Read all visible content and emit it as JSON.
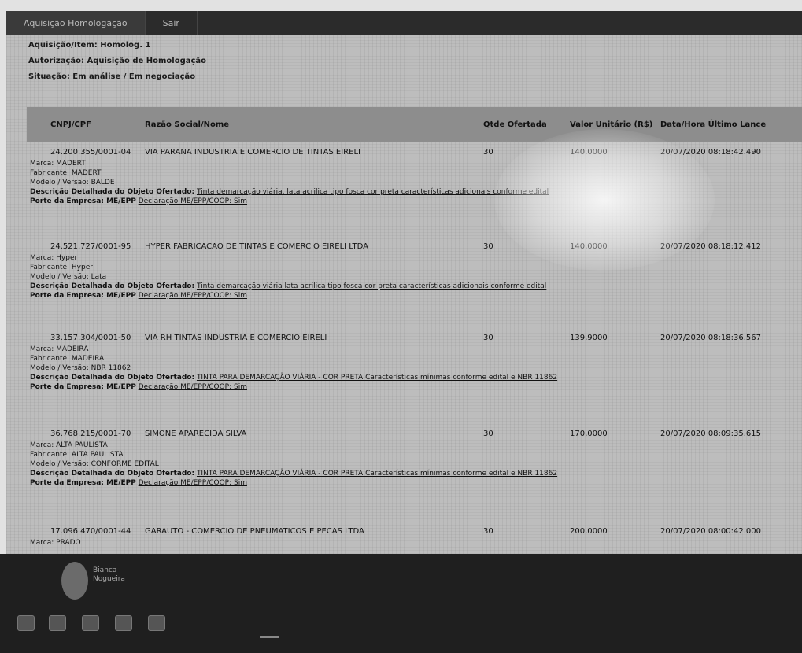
{
  "window": {
    "tabs": [
      {
        "label": "Aquisição Homologação"
      },
      {
        "label": "Sair"
      }
    ]
  },
  "info": {
    "line1": "Aquisição/Item: Homolog. 1",
    "line2": "Autorização: Aquisição de Homologação",
    "line3": "Situação: Em análise / Em negociação"
  },
  "table": {
    "headers": {
      "cnpj": "CNPJ/CPF",
      "razao": "Razão Social/Nome",
      "qtd": "Qtde Ofertada",
      "valor": "Valor Unitário (R$)",
      "data": "Data/Hora Último Lance"
    },
    "rows": [
      {
        "cnpj": "24.200.355/0001-04",
        "razao": "VIA PARANA INDUSTRIA E COMERCIO DE TINTAS EIRELI",
        "qtd": "30",
        "valor": "140,0000",
        "data": "20/07/2020 08:18:42.490",
        "marca": "Marca: MADERT",
        "fabricante": "Fabricante: MADERT",
        "modelo": "Modelo / Versão: BALDE",
        "descricao_label": "Descrição Detalhada do Objeto Ofertado:",
        "descricao": "Tinta demarcação viária. lata acrilica tipo fosca cor preta características adicionais conforme edital",
        "porte_label": "Porte da Empresa: ME/EPP",
        "declaracao": "Declaração ME/EPP/COOP: Sim"
      },
      {
        "cnpj": "24.521.727/0001-95",
        "razao": "HYPER FABRICACAO DE TINTAS E COMERCIO EIRELI LTDA",
        "qtd": "30",
        "valor": "140,0000",
        "data": "20/07/2020 08:18:12.412",
        "marca": "Marca: Hyper",
        "fabricante": "Fabricante: Hyper",
        "modelo": "Modelo / Versão: Lata",
        "descricao_label": "Descrição Detalhada do Objeto Ofertado:",
        "descricao": "Tinta demarcação viária lata acrilica tipo fosca cor preta características adicionais conforme edital",
        "porte_label": "Porte da Empresa: ME/EPP",
        "declaracao": "Declaração ME/EPP/COOP: Sim"
      },
      {
        "cnpj": "33.157.304/0001-50",
        "razao": "VIA RH TINTAS INDUSTRIA E COMERCIO EIRELI",
        "qtd": "30",
        "valor": "139,9000",
        "data": "20/07/2020 08:18:36.567",
        "marca": "Marca: MADEIRA",
        "fabricante": "Fabricante: MADEIRA",
        "modelo": "Modelo / Versão: NBR 11862",
        "descricao_label": "Descrição Detalhada do Objeto Ofertado:",
        "descricao": "TINTA PARA DEMARCAÇÃO VIÁRIA - COR PRETA Características mínimas conforme edital e NBR 11862",
        "porte_label": "Porte da Empresa: ME/EPP",
        "declaracao": "Declaração ME/EPP/COOP: Sim"
      },
      {
        "cnpj": "36.768.215/0001-70",
        "razao": "SIMONE APARECIDA SILVA",
        "qtd": "30",
        "valor": "170,0000",
        "data": "20/07/2020 08:09:35.615",
        "marca": "Marca: ALTA PAULISTA",
        "fabricante": "Fabricante: ALTA PAULISTA",
        "modelo": "Modelo / Versão: CONFORME EDITAL",
        "descricao_label": "Descrição Detalhada do Objeto Ofertado:",
        "descricao": "TINTA PARA DEMARCAÇÃO VIÁRIA - COR PRETA Características mínimas conforme edital e NBR 11862",
        "porte_label": "Porte da Empresa: ME/EPP",
        "declaracao": "Declaração ME/EPP/COOP: Sim"
      },
      {
        "cnpj": "17.096.470/0001-44",
        "razao": "GARAUTO - COMERCIO DE PNEUMATICOS E PECAS LTDA",
        "qtd": "30",
        "valor": "200,0000",
        "data": "20/07/2020 08:00:42.000",
        "marca": "Marca: PRADO",
        "fabricante": "",
        "modelo": "",
        "descricao_label": "",
        "descricao": "",
        "porte_label": "",
        "declaracao": ""
      }
    ]
  },
  "taskbar": {
    "user_name": "Bianca Nogueira"
  }
}
